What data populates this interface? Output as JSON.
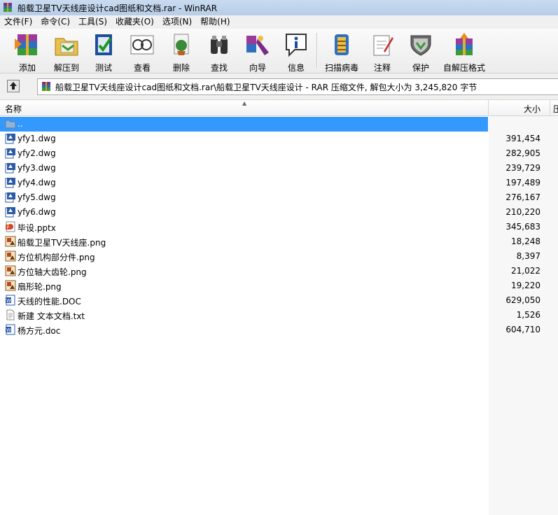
{
  "window": {
    "title": "船载卫星TV天线座设计cad图纸和文档.rar - WinRAR"
  },
  "menu": [
    "文件(F)",
    "命令(C)",
    "工具(S)",
    "收藏夹(O)",
    "选项(N)",
    "帮助(H)"
  ],
  "toolbar": [
    {
      "label": "添加",
      "icon": "add-archive-icon"
    },
    {
      "label": "解压到",
      "icon": "extract-to-icon"
    },
    {
      "label": "测试",
      "icon": "test-icon"
    },
    {
      "label": "查看",
      "icon": "view-icon"
    },
    {
      "label": "删除",
      "icon": "delete-icon"
    },
    {
      "label": "查找",
      "icon": "find-icon"
    },
    {
      "label": "向导",
      "icon": "wizard-icon"
    },
    {
      "label": "信息",
      "icon": "info-icon"
    },
    {
      "label": "扫描病毒",
      "icon": "scan-virus-icon"
    },
    {
      "label": "注释",
      "icon": "comment-icon"
    },
    {
      "label": "保护",
      "icon": "protect-icon"
    },
    {
      "label": "自解压格式",
      "icon": "sfx-icon"
    }
  ],
  "address": {
    "text": "船载卫星TV天线座设计cad图纸和文档.rar\\船载卫星TV天线座设计 - RAR 压缩文件, 解包大小为 3,245,820 字节"
  },
  "columns": {
    "name": "名称",
    "size": "大小",
    "packed": "压"
  },
  "files": [
    {
      "name": "..",
      "size": "",
      "type": "parent",
      "selected": true
    },
    {
      "name": "yfy1.dwg",
      "size": "391,454",
      "type": "dwg"
    },
    {
      "name": "yfy2.dwg",
      "size": "282,905",
      "type": "dwg"
    },
    {
      "name": "yfy3.dwg",
      "size": "239,729",
      "type": "dwg"
    },
    {
      "name": "yfy4.dwg",
      "size": "197,489",
      "type": "dwg"
    },
    {
      "name": "yfy5.dwg",
      "size": "276,167",
      "type": "dwg"
    },
    {
      "name": "yfy6.dwg",
      "size": "210,220",
      "type": "dwg"
    },
    {
      "name": "毕设.pptx",
      "size": "345,683",
      "type": "pptx"
    },
    {
      "name": "船载卫星TV天线座.png",
      "size": "18,248",
      "type": "png"
    },
    {
      "name": "方位机构部分件.png",
      "size": "8,397",
      "type": "png"
    },
    {
      "name": "方位轴大齿轮.png",
      "size": "21,022",
      "type": "png"
    },
    {
      "name": "扇形轮.png",
      "size": "19,220",
      "type": "png"
    },
    {
      "name": "天线的性能.DOC",
      "size": "629,050",
      "type": "doc"
    },
    {
      "name": "新建 文本文档.txt",
      "size": "1,526",
      "type": "txt"
    },
    {
      "name": "杨方元.doc",
      "size": "604,710",
      "type": "doc"
    }
  ]
}
